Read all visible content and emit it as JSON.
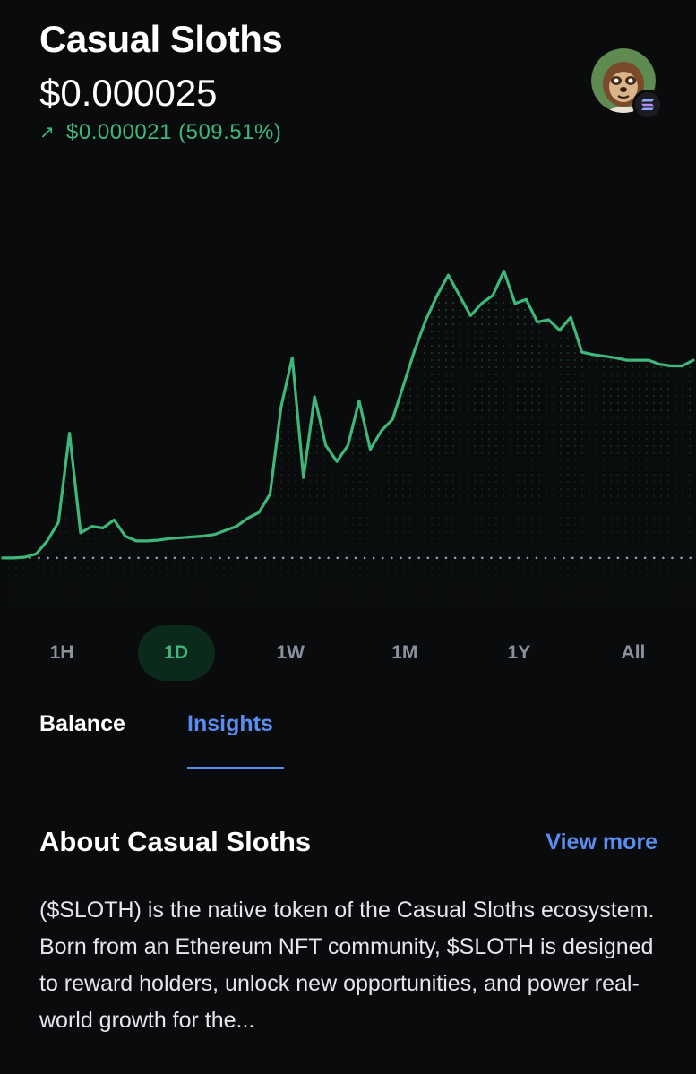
{
  "token": {
    "name": "Casual Sloths",
    "price": "$0.000025",
    "change_arrow_icon": "arrow-up-right-icon",
    "change_text": "$0.000021 (509.51%)",
    "change_color": "#3fb77b",
    "avatar_icon": "sloth-avatar-icon",
    "chain_badge_icon": "solana-icon"
  },
  "chart_data": {
    "type": "area",
    "color": "#3fb77b",
    "title": "",
    "xlabel": "",
    "ylabel": "",
    "grid": false,
    "baseline_dotted": true,
    "y": [
      4.1e-06,
      4.1e-06,
      4.2e-06,
      4.6e-06,
      6.2e-06,
      8.5e-06,
      1.95e-05,
      7.2e-06,
      8e-06,
      7.8e-06,
      8.8e-06,
      6.8e-06,
      6.2e-06,
      6.2e-06,
      6.3e-06,
      6.5e-06,
      6.6e-06,
      6.7e-06,
      6.8e-06,
      7e-06,
      7.5e-06,
      8e-06,
      9e-06,
      9.7e-06,
      1.2e-05,
      2.28e-05,
      2.88e-05,
      1.4e-05,
      2.4e-05,
      1.8e-05,
      1.6e-05,
      1.8e-05,
      2.35e-05,
      1.75e-05,
      1.98e-05,
      2.12e-05,
      2.55e-05,
      2.98e-05,
      3.35e-05,
      3.65e-05,
      3.9e-05,
      3.65e-05,
      3.4e-05,
      3.55e-05,
      3.65e-05,
      3.95e-05,
      3.55e-05,
      3.6e-05,
      3.32e-05,
      3.35e-05,
      3.22e-05,
      3.38e-05,
      2.95e-05,
      2.92e-05,
      2.9e-05,
      2.88e-05,
      2.85e-05,
      2.85e-05,
      2.85e-05,
      2.8e-05,
      2.78e-05,
      2.78e-05,
      2.85e-05
    ]
  },
  "time_ranges": {
    "options": [
      "1H",
      "1D",
      "1W",
      "1M",
      "1Y",
      "All"
    ],
    "selected": "1D"
  },
  "tabs": {
    "balance": "Balance",
    "insights": "Insights",
    "active": "Insights"
  },
  "about": {
    "title": "About Casual Sloths",
    "view_more": "View more",
    "description": "($SLOTH) is the native token of the Casual Sloths ecosystem. Born from an Ethereum NFT community, $SLOTH is designed to reward holders, unlock new opportunities, and power real-world growth for the..."
  }
}
